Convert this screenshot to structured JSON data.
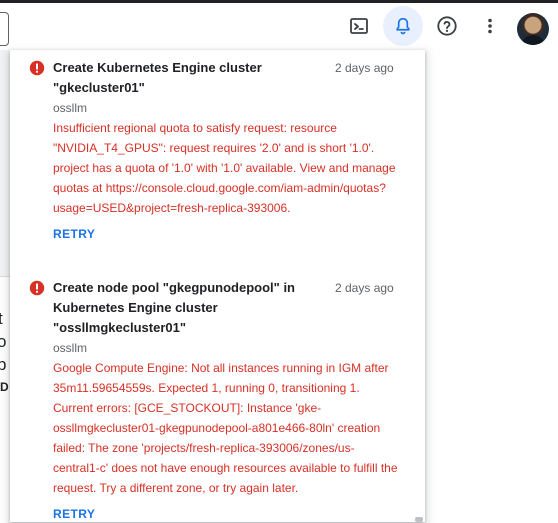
{
  "header": {
    "icons": {
      "terminal": "terminal-icon",
      "notifications": "bell-icon",
      "help": "help-icon",
      "more": "more-vert-icon"
    }
  },
  "background_fragments": [
    "t",
    "o",
    "p",
    "D"
  ],
  "notifications": [
    {
      "title": "Create Kubernetes Engine cluster \"gkecluster01\"",
      "time": "2 days ago",
      "project": "ossllm",
      "message": "Insufficient regional quota to satisfy request: resource \"NVIDIA_T4_GPUS\": request requires '2.0' and is short '1.0'. project has a quota of '1.0' with '1.0' available. View and manage quotas at https://console.cloud.google.com/iam-admin/quotas?usage=USED&project=fresh-replica-393006.",
      "action": "RETRY"
    },
    {
      "title": "Create node pool \"gkegpunodepool\" in Kubernetes Engine cluster \"ossllmgkecluster01\"",
      "time": "2 days ago",
      "project": "ossllm",
      "message": "Google Compute Engine: Not all instances running in IGM after 35m11.59654559s. Expected 1, running 0, transitioning 1. Current errors: [GCE_STOCKOUT]: Instance 'gke-ossllmgkecluster01-gkegpunodepool-a801e466-80ln' creation failed: The zone 'projects/fresh-replica-393006/zones/us-central1-c' does not have enough resources available to fulfill the request. Try a different zone, or try again later.",
      "action": "RETRY"
    }
  ],
  "colors": {
    "error": "#d93025",
    "accent": "#1a73e8",
    "active_button_bg": "#e8f0fe"
  }
}
